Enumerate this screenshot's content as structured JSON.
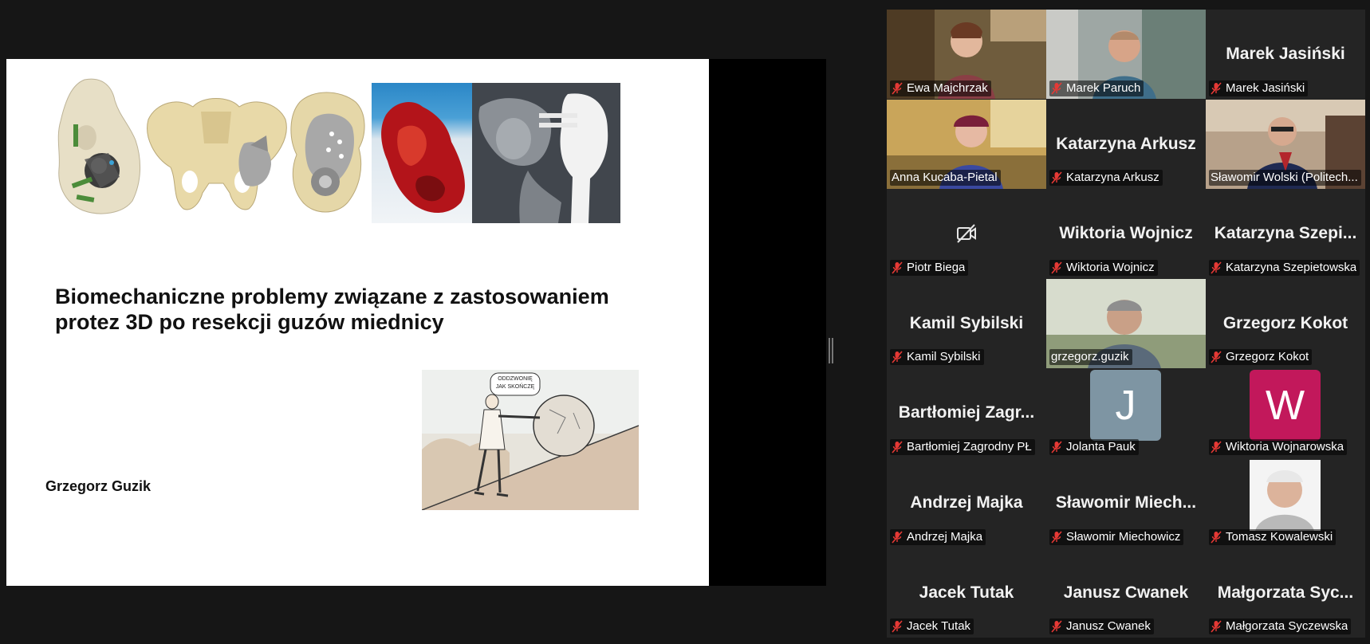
{
  "slide": {
    "title": "Biomechaniczne problemy związane z zastosowaniem protez 3D po resekcji guzów miednicy",
    "author": "Grzegorz Guzik",
    "cartoon_caption": "ODDZWONIĘ JAK SKOŃCZĘ"
  },
  "gallery": {
    "participants": [
      {
        "name": "Ewa Majchrzak",
        "display": "",
        "muted": true,
        "tile": "video"
      },
      {
        "name": "Marek Paruch",
        "display": "",
        "muted": true,
        "tile": "video"
      },
      {
        "name": "Marek Jasiński",
        "display": "Marek Jasiński",
        "muted": true,
        "tile": "name"
      },
      {
        "name": "Anna Kucaba-Pietal",
        "display": "",
        "muted": false,
        "tile": "video"
      },
      {
        "name": "Katarzyna Arkusz",
        "display": "Katarzyna Arkusz",
        "muted": true,
        "tile": "name"
      },
      {
        "name": "Sławomir Wolski (Politech...",
        "display": "",
        "muted": false,
        "tile": "video"
      },
      {
        "name": "Piotr Biega",
        "display": "",
        "muted": true,
        "tile": "camera-off"
      },
      {
        "name": "Wiktoria Wojnicz",
        "display": "Wiktoria Wojnicz",
        "muted": true,
        "tile": "name"
      },
      {
        "name": "Katarzyna Szepietowska",
        "display": "Katarzyna Szepi...",
        "muted": true,
        "tile": "name"
      },
      {
        "name": "Kamil Sybilski",
        "display": "Kamil Sybilski",
        "muted": true,
        "tile": "name"
      },
      {
        "name": "grzegorz.guzik",
        "display": "",
        "muted": false,
        "tile": "video",
        "active": true
      },
      {
        "name": "Grzegorz Kokot",
        "display": "Grzegorz Kokot",
        "muted": true,
        "tile": "name"
      },
      {
        "name": "Bartłomiej Zagrodny PŁ",
        "display": "Bartłomiej Zagr...",
        "muted": true,
        "tile": "name"
      },
      {
        "name": "Jolanta Pauk",
        "display": "",
        "muted": true,
        "tile": "avatar",
        "avatar_letter": "J",
        "avatar_color": "#7e95a3"
      },
      {
        "name": "Wiktoria Wojnarowska",
        "display": "",
        "muted": true,
        "tile": "avatar",
        "avatar_letter": "W",
        "avatar_color": "#c2185b"
      },
      {
        "name": "Andrzej Majka",
        "display": "Andrzej Majka",
        "muted": true,
        "tile": "name"
      },
      {
        "name": "Sławomir Miechowicz",
        "display": "Sławomir Miech...",
        "muted": true,
        "tile": "name"
      },
      {
        "name": "Tomasz Kowalewski",
        "display": "",
        "muted": true,
        "tile": "photo"
      },
      {
        "name": "Jacek Tutak",
        "display": "Jacek Tutak",
        "muted": true,
        "tile": "name"
      },
      {
        "name": "Janusz Cwanek",
        "display": "Janusz Cwanek",
        "muted": true,
        "tile": "name"
      },
      {
        "name": "Małgorzata Syczewska",
        "display": "Małgorzata Syc...",
        "muted": true,
        "tile": "name"
      }
    ]
  },
  "colors": {
    "background": "#161616",
    "tile": "#242424",
    "active_speaker": "#25d07a",
    "muted_icon": "#e53935"
  },
  "icons": {
    "muted": "microphone-muted-icon",
    "camera_off": "video-off-icon",
    "splitter": "drag-handle-icon"
  }
}
